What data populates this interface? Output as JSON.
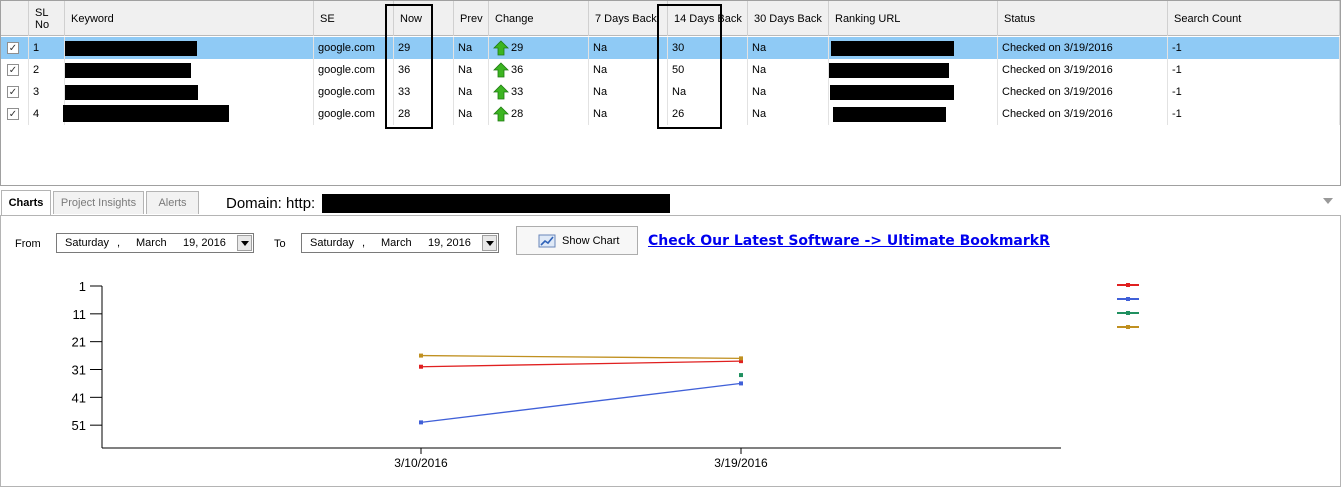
{
  "grid": {
    "columns": [
      {
        "id": "check",
        "label": ""
      },
      {
        "id": "sl",
        "label": "SL No"
      },
      {
        "id": "keyword",
        "label": "Keyword"
      },
      {
        "id": "se",
        "label": "SE"
      },
      {
        "id": "now",
        "label": "Now"
      },
      {
        "id": "prev",
        "label": "Prev"
      },
      {
        "id": "change",
        "label": "Change"
      },
      {
        "id": "d7",
        "label": "7 Days Back"
      },
      {
        "id": "d14",
        "label": "14 Days Back"
      },
      {
        "id": "d30",
        "label": "30 Days Back"
      },
      {
        "id": "url",
        "label": "Ranking URL"
      },
      {
        "id": "status",
        "label": "Status"
      },
      {
        "id": "count",
        "label": "Search Count"
      }
    ],
    "rows": [
      {
        "checked": true,
        "sl": "1",
        "se": "google.com",
        "now": "29",
        "prev": "Na",
        "change": "29",
        "d7": "Na",
        "d14": "30",
        "d30": "Na",
        "status": "Checked on 3/19/2016",
        "count": "-1",
        "selected": true
      },
      {
        "checked": true,
        "sl": "2",
        "se": "google.com",
        "now": "36",
        "prev": "Na",
        "change": "36",
        "d7": "Na",
        "d14": "50",
        "d30": "Na",
        "status": "Checked on 3/19/2016",
        "count": "-1",
        "selected": false
      },
      {
        "checked": true,
        "sl": "3",
        "se": "google.com",
        "now": "33",
        "prev": "Na",
        "change": "33",
        "d7": "Na",
        "d14": "Na",
        "d30": "Na",
        "status": "Checked on 3/19/2016",
        "count": "-1",
        "selected": false
      },
      {
        "checked": true,
        "sl": "4",
        "se": "google.com",
        "now": "28",
        "prev": "Na",
        "change": "28",
        "d7": "Na",
        "d14": "26",
        "d30": "Na",
        "status": "Checked on 3/19/2016",
        "count": "-1",
        "selected": false
      }
    ]
  },
  "tabs": [
    {
      "label": "Charts",
      "active": true
    },
    {
      "label": "Project Insights",
      "active": false
    },
    {
      "label": "Alerts",
      "active": false
    }
  ],
  "domain": {
    "label": "Domain: http:"
  },
  "controls": {
    "from_label": "From",
    "to_label": "To",
    "from_date": {
      "day": "Saturday",
      "comma": ",",
      "month": "March",
      "date": "19, 2016"
    },
    "to_date": {
      "day": "Saturday",
      "comma": ",",
      "month": "March",
      "date": "19, 2016"
    },
    "show_chart_label": "Show Chart",
    "promo_link": "Check Our Latest Software -> Ultimate BookmarkR"
  },
  "colors": {
    "selected_row": "#8fcaf5",
    "link": "#0000ee",
    "arrow_green": "#3cb521"
  },
  "chart_data": {
    "type": "line",
    "x": [
      "3/10/2016",
      "3/19/2016"
    ],
    "y_axis": {
      "reversed": true,
      "ticks": [
        1,
        11,
        21,
        31,
        41,
        51
      ],
      "range": [
        1,
        61
      ]
    },
    "grid": false,
    "legend": "right",
    "series": [
      {
        "color": "#e02020",
        "values": [
          30,
          28
        ]
      },
      {
        "color": "#4060d8",
        "values": [
          50,
          36
        ]
      },
      {
        "color": "#209060",
        "values": [
          null,
          33
        ]
      },
      {
        "color": "#c09020",
        "values": [
          26,
          27
        ]
      }
    ]
  }
}
